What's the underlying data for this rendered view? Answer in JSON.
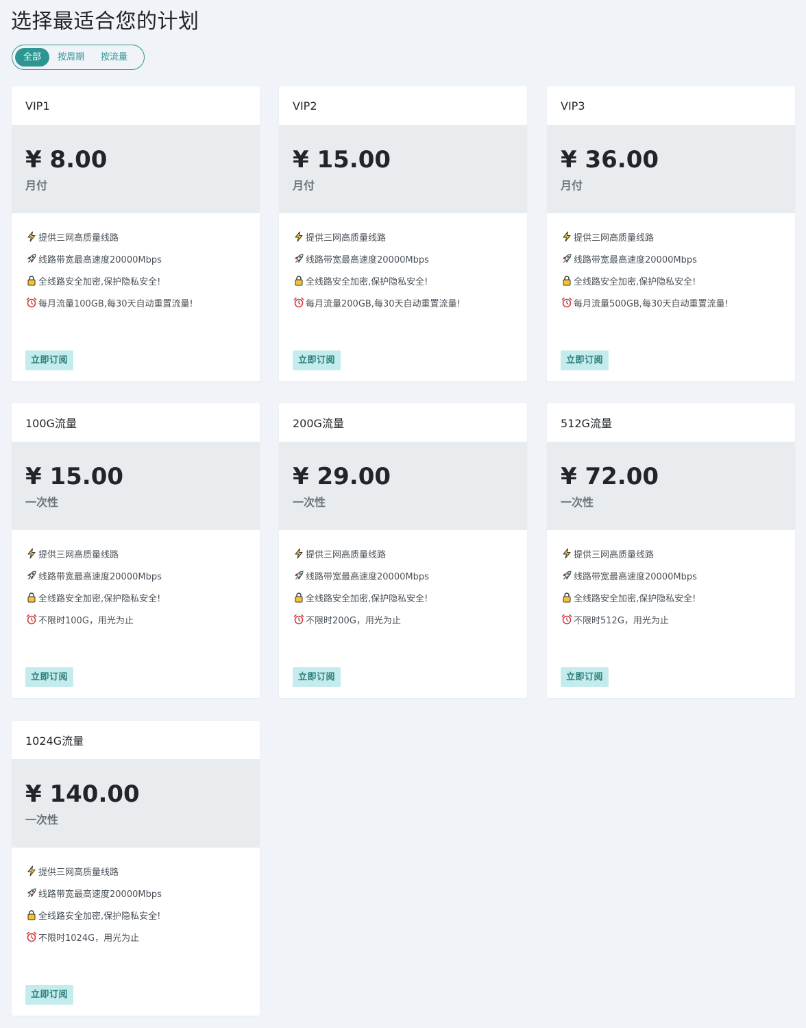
{
  "title": "选择最适合您的计划",
  "filters": [
    {
      "label": "全部",
      "active": true
    },
    {
      "label": "按周期",
      "active": false
    },
    {
      "label": "按流量",
      "active": false
    }
  ],
  "icons": [
    "lightning-icon",
    "rocket-icon",
    "lock-icon",
    "alarm-clock-icon"
  ],
  "accent_color": "#2e9692",
  "plans": [
    {
      "name": "VIP1",
      "price": "¥ 8.00",
      "period": "月付",
      "features": [
        "提供三网高质量线路",
        "线路带宽最高速度20000Mbps",
        "全线路安全加密,保护隐私安全!",
        "每月流量100GB,每30天自动重置流量!"
      ],
      "button": "立即订阅"
    },
    {
      "name": "VIP2",
      "price": "¥ 15.00",
      "period": "月付",
      "features": [
        "提供三网高质量线路",
        "线路带宽最高速度20000Mbps",
        "全线路安全加密,保护隐私安全!",
        "每月流量200GB,每30天自动重置流量!"
      ],
      "button": "立即订阅"
    },
    {
      "name": "VIP3",
      "price": "¥ 36.00",
      "period": "月付",
      "features": [
        "提供三网高质量线路",
        "线路带宽最高速度20000Mbps",
        "全线路安全加密,保护隐私安全!",
        "每月流量500GB,每30天自动重置流量!"
      ],
      "button": "立即订阅"
    },
    {
      "name": "100G流量",
      "price": "¥ 15.00",
      "period": "一次性",
      "features": [
        "提供三网高质量线路",
        "线路带宽最高速度20000Mbps",
        "全线路安全加密,保护隐私安全!",
        "不限时100G，用光为止"
      ],
      "button": "立即订阅"
    },
    {
      "name": "200G流量",
      "price": "¥ 29.00",
      "period": "一次性",
      "features": [
        "提供三网高质量线路",
        "线路带宽最高速度20000Mbps",
        "全线路安全加密,保护隐私安全!",
        "不限时200G，用光为止"
      ],
      "button": "立即订阅"
    },
    {
      "name": "512G流量",
      "price": "¥ 72.00",
      "period": "一次性",
      "features": [
        "提供三网高质量线路",
        "线路带宽最高速度20000Mbps",
        "全线路安全加密,保护隐私安全!",
        "不限时512G，用光为止"
      ],
      "button": "立即订阅"
    },
    {
      "name": "1024G流量",
      "price": "¥ 140.00",
      "period": "一次性",
      "features": [
        "提供三网高质量线路",
        "线路带宽最高速度20000Mbps",
        "全线路安全加密,保护隐私安全!",
        "不限时1024G，用光为止"
      ],
      "button": "立即订阅"
    }
  ]
}
